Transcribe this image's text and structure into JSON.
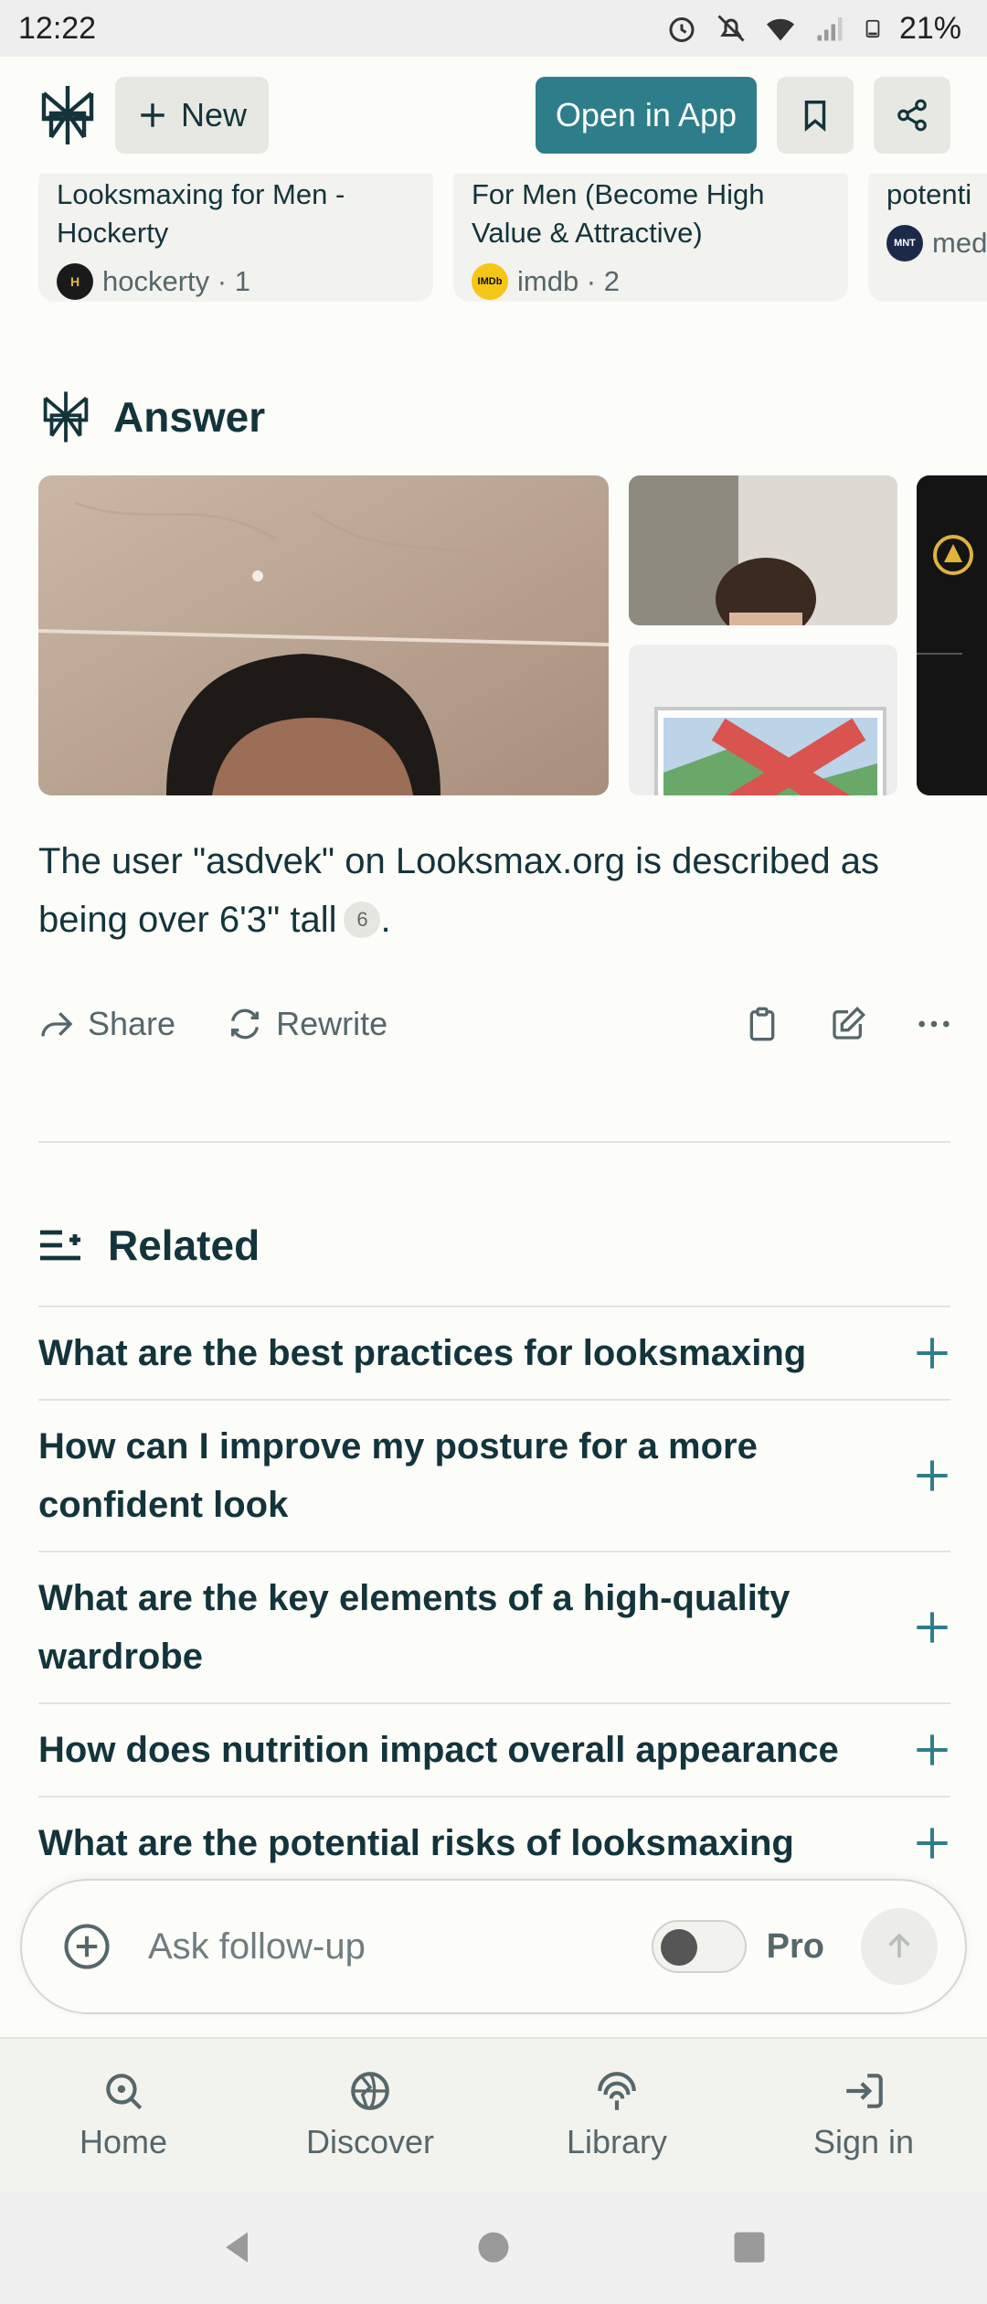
{
  "status_bar": {
    "time": "12:22",
    "battery": "21%"
  },
  "header": {
    "new_label": "New",
    "open_app_label": "Open in App"
  },
  "sources": [
    {
      "title": "Looksmaxing for Men - Hockerty",
      "site": "hockerty · 1",
      "icon_text": "H"
    },
    {
      "title": "For Men (Become High Value & Attractive)",
      "site": "imdb · 2",
      "icon_text": "IMDb"
    },
    {
      "title": "potenti",
      "site": "med",
      "icon_text": "MNT"
    }
  ],
  "answer": {
    "heading": "Answer",
    "text": "The user \"asdvek\" on Looksmax.org is described as being over 6'3\" tall",
    "citation": "6",
    "end": "."
  },
  "actions": {
    "share": "Share",
    "rewrite": "Rewrite"
  },
  "related": {
    "heading": "Related",
    "items": [
      "What are the best practices for looksmaxing",
      "How can I improve my posture for a more confident look",
      "What are the key elements of a high-quality wardrobe",
      "How does nutrition impact overall appearance",
      "What are the potential risks of looksmaxing"
    ]
  },
  "followup": {
    "placeholder": "Ask follow-up",
    "pro_label": "Pro"
  },
  "nav": {
    "home": "Home",
    "discover": "Discover",
    "library": "Library",
    "signin": "Sign in"
  },
  "colors": {
    "accent": "#2e7d8a",
    "text": "#13343b",
    "muted": "#55676b",
    "background": "#fcfcf9"
  }
}
